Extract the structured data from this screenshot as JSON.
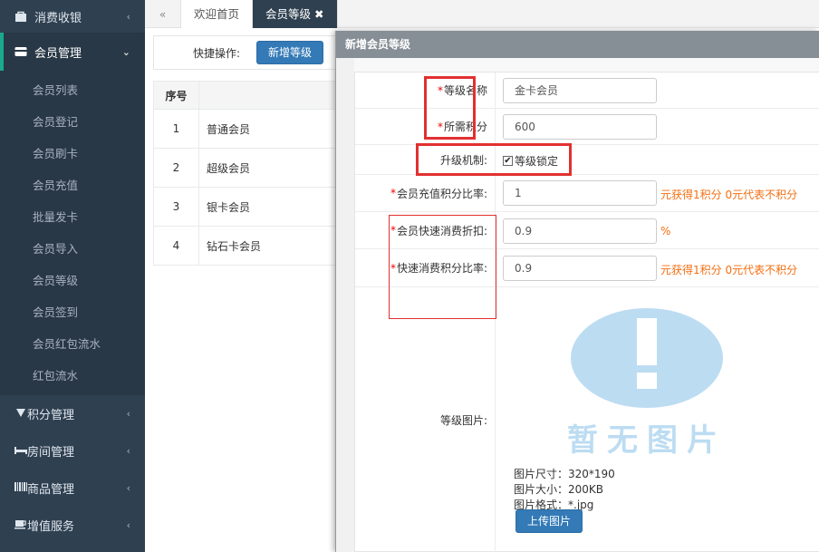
{
  "sidebar": {
    "top_item": "消费收银",
    "active_item": "会员管理",
    "submenu": [
      "会员列表",
      "会员登记",
      "会员刷卡",
      "会员充值",
      "批量发卡",
      "会员导入",
      "会员等级",
      "会员签到",
      "会员红包流水",
      "红包流水"
    ],
    "bottom_items": [
      "积分管理",
      "房间管理",
      "商品管理",
      "增值服务"
    ]
  },
  "tabs": {
    "back_icon": "«",
    "home": "欢迎首页",
    "current": "会员等级",
    "close_icon": "✖"
  },
  "quick": {
    "label": "快捷操作:",
    "add_button": "新增等级"
  },
  "table": {
    "headers": [
      "序号"
    ],
    "rows": [
      {
        "no": "1",
        "name": "普通会员"
      },
      {
        "no": "2",
        "name": "超级会员"
      },
      {
        "no": "3",
        "name": "银卡会员"
      },
      {
        "no": "4",
        "name": "钻石卡会员"
      }
    ]
  },
  "modal": {
    "title": "新增会员等级",
    "required_mark": "*",
    "fields": {
      "level_name_label": "等级名称",
      "level_name_value": "金卡会员",
      "points_label": "所需积分",
      "points_value": "600",
      "upgrade_label": "升级机制:",
      "upgrade_checkbox": "等级锁定",
      "recharge_ratio_label": "会员充值积分比率:",
      "recharge_ratio_value": "1",
      "recharge_ratio_hint": "元获得1积分 0元代表不积分",
      "discount_label": "会员快速消费折扣:",
      "discount_value": "0.9",
      "discount_hint": "%",
      "consume_ratio_label": "快速消费积分比率:",
      "consume_ratio_value": "0.9",
      "consume_ratio_hint": "元获得1积分 0元代表不积分",
      "image_label": "等级图片:",
      "placeholder_text": "暂无图片",
      "image_size": "图片尺寸：320*190",
      "image_filesize": "图片大小：200KB",
      "image_format": "图片格式：*.jpg",
      "upload_button": "上传图片"
    }
  },
  "colors": {
    "sidebar_bg": "#2f4050",
    "accent_blue": "#337ab7",
    "hint_orange": "#f36f12",
    "highlight_red": "#e23030"
  }
}
